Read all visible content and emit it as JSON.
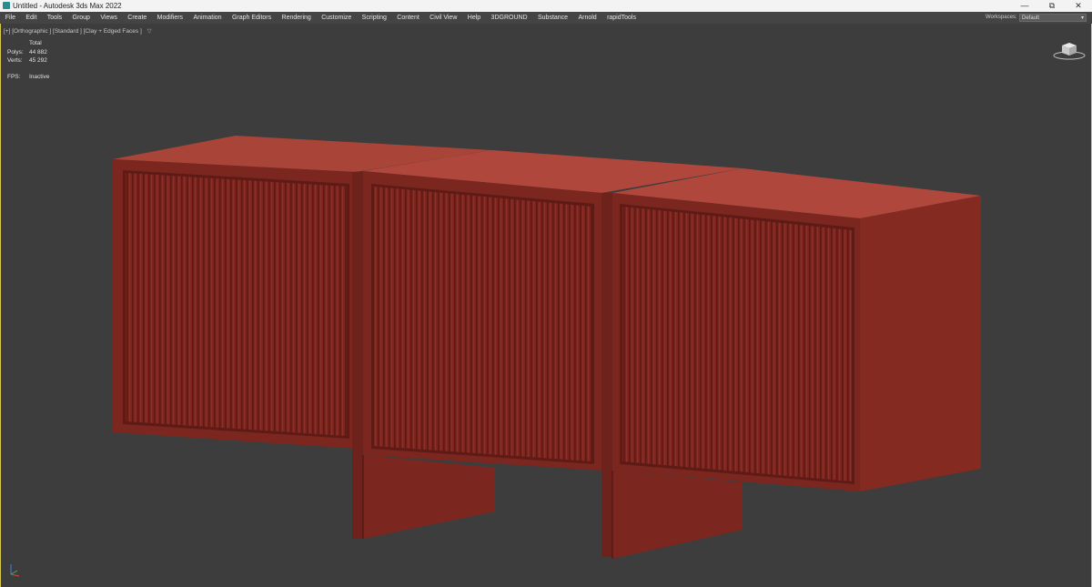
{
  "window": {
    "title": "Untitled - Autodesk 3ds Max 2022",
    "controls": [
      "—",
      "⧉",
      "✕"
    ]
  },
  "menubar": {
    "items": [
      "File",
      "Edit",
      "Tools",
      "Group",
      "Views",
      "Create",
      "Modifiers",
      "Animation",
      "Graph Editors",
      "Rendering",
      "Customize",
      "Scripting",
      "Content",
      "Civil View",
      "Help",
      "3DGROUND",
      "Substance",
      "Arnold",
      "rapidTools"
    ],
    "workspaces_label": "Workspaces:",
    "workspace_value": "Default"
  },
  "viewport": {
    "label": "[+] [Orthographic ] [Standard ] [Clay + Edged Faces ]",
    "filter_icon": "funnel-icon",
    "stats": {
      "header": "Total",
      "polys_label": "Polys:",
      "polys_value": "44 882",
      "verts_label": "Verts:",
      "verts_value": "45 292"
    },
    "fps_label": "FPS:",
    "fps_value": "Inactive"
  },
  "colors": {
    "menubar_bg": "#444444",
    "viewport_bg": "#3d3d3d",
    "viewport_border": "#d8c94a",
    "clay_front": "#7c2620",
    "clay_top": "#b0473c",
    "clay_side": "#83281f"
  }
}
